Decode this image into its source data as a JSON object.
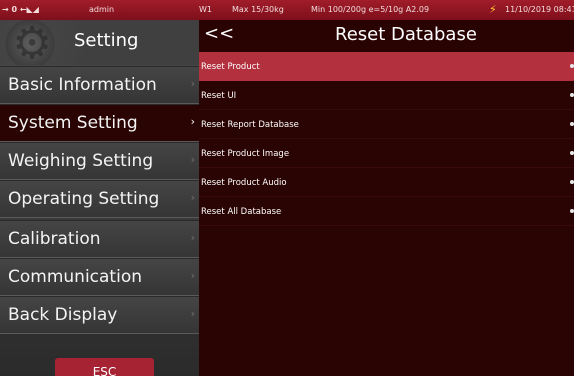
{
  "status_bar": {
    "icons": "→ 0 ←◣◢",
    "user": "admin",
    "scale": "W1",
    "max": "Max 15/30kg",
    "min": "Min 100/200g e=5/10g A2.09",
    "power_icon": "bolt-icon",
    "datetime": "11/10/2019 08:41"
  },
  "sidebar": {
    "title": "Setting",
    "items": [
      {
        "label": "Basic Information",
        "active": false
      },
      {
        "label": "System Setting",
        "active": true
      },
      {
        "label": "Weighing Setting",
        "active": false
      },
      {
        "label": "Operating Setting",
        "active": false
      },
      {
        "label": "Calibration",
        "active": false
      },
      {
        "label": "Communication",
        "active": false
      },
      {
        "label": "Back Display",
        "active": false
      }
    ],
    "chevron": "›",
    "esc_label": "ESC"
  },
  "main": {
    "back_label": "<<",
    "title": "Reset Database",
    "rows": [
      {
        "label": "Reset Product",
        "selected": true
      },
      {
        "label": "Reset UI",
        "selected": false
      },
      {
        "label": "Reset Report Database",
        "selected": false
      },
      {
        "label": "Reset Product Image",
        "selected": false
      },
      {
        "label": "Reset Product Audio",
        "selected": false
      },
      {
        "label": "Reset All Database",
        "selected": false
      }
    ]
  },
  "colors": {
    "accent_red": "#b3303e",
    "panel_dark_red": "#2a0303",
    "sidebar_gray": "#404040",
    "esc_red": "#a52333"
  }
}
